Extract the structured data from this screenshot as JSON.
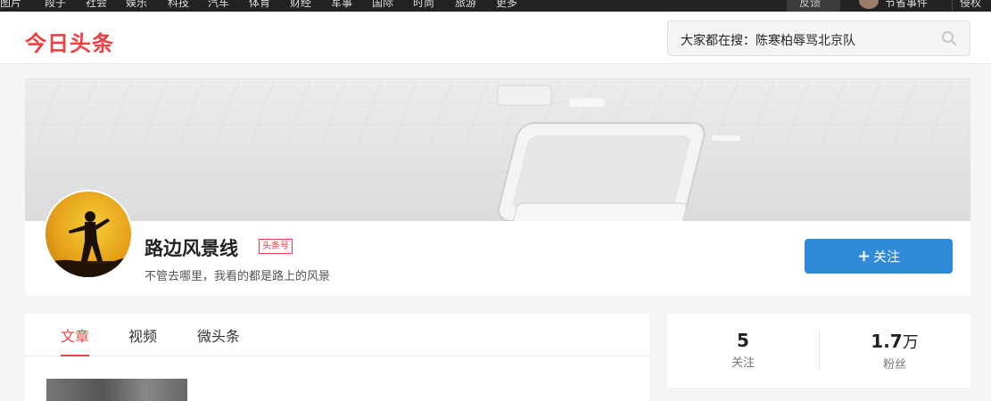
{
  "topnav": {
    "items": [
      "图片",
      "段子",
      "社会",
      "娱乐",
      "科技",
      "汽车",
      "体育",
      "财经",
      "军事",
      "国际",
      "时尚",
      "旅游",
      "更多"
    ],
    "feedback": "反馈",
    "user": "节省事件",
    "last": "侵权"
  },
  "header": {
    "logo": "今日头条",
    "search_text": "大家都在搜：陈寒柏辱骂北京队"
  },
  "profile": {
    "name": "路边风景线",
    "badge": "头条号",
    "bio": "不管去哪里，我看的都是路上的风景",
    "follow_label": "关注",
    "follow_plus": "+"
  },
  "tabs": [
    {
      "label": "文章",
      "active": true
    },
    {
      "label": "视频",
      "active": false
    },
    {
      "label": "微头条",
      "active": false
    }
  ],
  "stats": {
    "following": {
      "value": "5",
      "label": "关注"
    },
    "fans": {
      "value": "1.7",
      "unit": "万",
      "label": "粉丝"
    }
  },
  "colors": {
    "accent": "#ed4040",
    "follow_button": "#2f8bd9",
    "topnav_bg": "#222222"
  },
  "icons": [
    "search-icon",
    "avatar",
    "banner-image"
  ]
}
